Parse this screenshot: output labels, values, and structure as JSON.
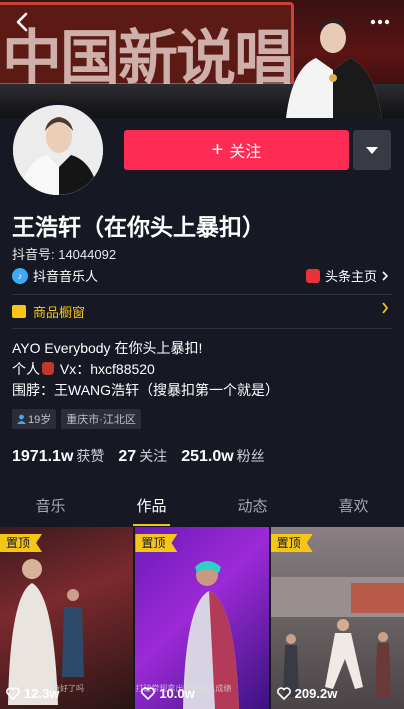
{
  "banner": {
    "sign_text": "中国新说唱"
  },
  "header": {
    "back_icon": "chevron-left-icon",
    "more_icon": "more-dots-icon"
  },
  "profile": {
    "follow_label": "关注",
    "name": "王浩轩（在你头上暴扣）",
    "douyin_id": "抖音号: 14044092",
    "music_badge": "抖音音乐人",
    "toutiao_link": "头条主页",
    "shop_label": "商品橱窗",
    "bio_line1": "AYO Everybody 在你头上暴扣!",
    "bio_line2_prefix": "个人",
    "bio_line2_suffix": "Vx：hxcf88520",
    "bio_line3": "围脖：王WANG浩轩（搜暴扣第一个就是）",
    "tags": [
      "19岁",
      "重庆市·江北区"
    ]
  },
  "stats": {
    "likes_num": "1971.1w",
    "likes_label": "获赞",
    "following_num": "27",
    "following_label": "关注",
    "followers_num": "251.0w",
    "followers_label": "粉丝"
  },
  "tabs": [
    "音乐",
    "作品",
    "动态",
    "喜欢"
  ],
  "active_tab": "作品",
  "videos": [
    {
      "pin": "置顶",
      "likes": "12.3w",
      "caption": "备好了吗"
    },
    {
      "pin": "置顶",
      "likes": "10.0w",
      "caption": "打破常规拿出我的惊人成绩"
    },
    {
      "pin": "置顶",
      "likes": "209.2w",
      "caption": ""
    }
  ],
  "colors": {
    "background": "#161823",
    "follow": "#fe2c55",
    "accent": "#f5c518"
  }
}
